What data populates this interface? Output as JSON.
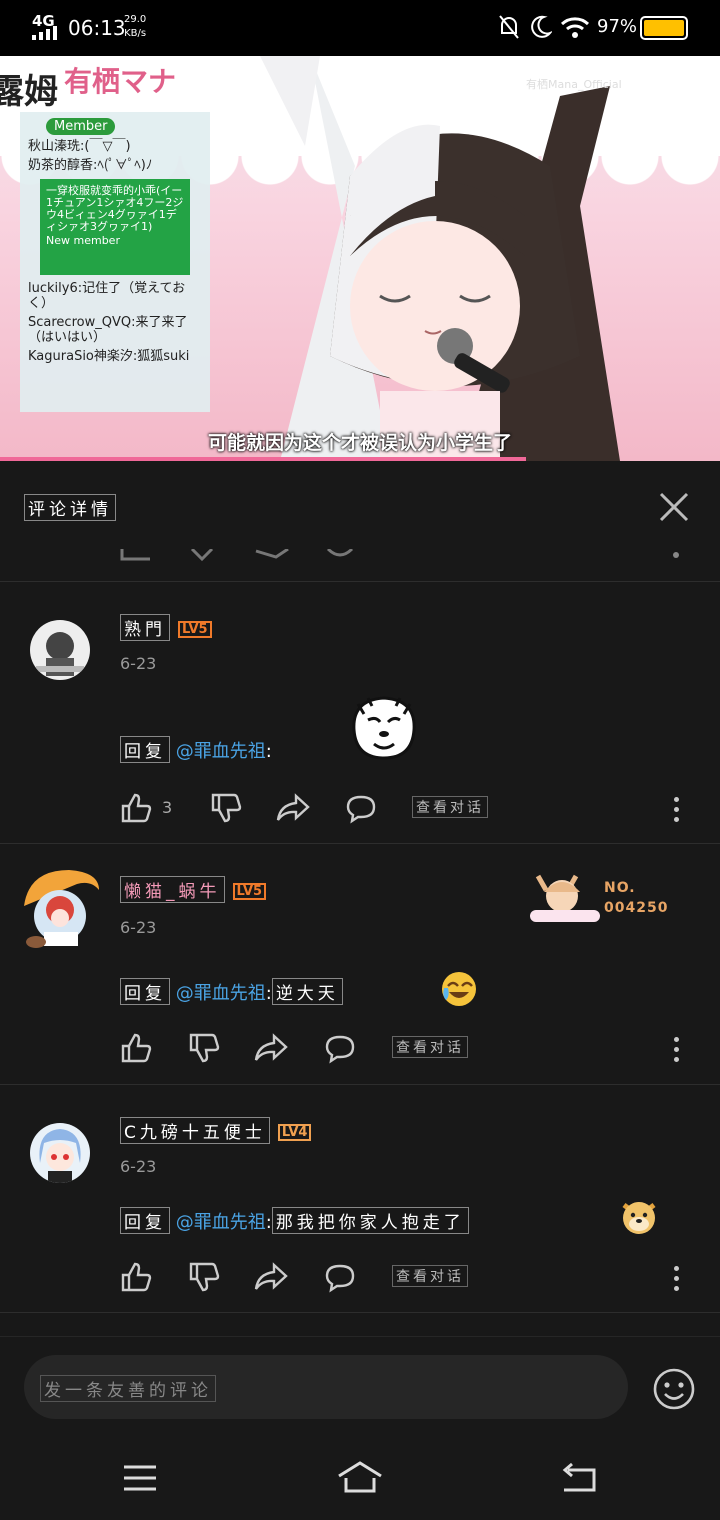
{
  "status_bar": {
    "network": "4G",
    "time": "06:13",
    "speed_value": "29.0",
    "speed_unit": "KB/s",
    "battery": "97%"
  },
  "video": {
    "stream_name": "露姆",
    "logo": "有栖マナ",
    "watermark": "有栖Mana_Official",
    "subtitle": "可能就因为这个才被误认为小学生了",
    "progress": 0.73,
    "chat": {
      "badge": "Member",
      "lines": [
        {
          "user": "秋山溱珗:",
          "text": "(￣▽￣)"
        },
        {
          "user": "奶茶的醇香:",
          "text": "ﾍ(ﾟ∀ﾟﾍ)ﾉ"
        },
        {
          "user": "luckily6:",
          "text": "记住了（覚えておく）"
        },
        {
          "user": "Scarecrow_QVQ:",
          "text": "来了来了（はいはい）"
        },
        {
          "user": "KaguraSio神楽汐:",
          "text": "狐狐suki"
        }
      ],
      "new_member_text": "一穿校服就变乖的小乖(イー1チュアン1シァオ4フー2ジウ4ビィェン4グヮァイ1ディシァオ3グヮァイ1)",
      "new_member_label": "New member"
    }
  },
  "panel": {
    "title": "评论详情"
  },
  "comments": [
    {
      "username": "熟門",
      "level": "LV5",
      "date": "6-23",
      "reply_prefix": "回复",
      "mention": "@罪血先祖",
      "colon": ":",
      "text": "",
      "emoji": "cat-sticker",
      "likes": "3",
      "view_conversation": "查看对话"
    },
    {
      "username": "懒猫_蜗牛",
      "level": "LV5",
      "date": "6-23",
      "reply_prefix": "回复",
      "mention": "@罪血先祖",
      "colon": ":",
      "text": "逆大天",
      "emoji": "laugh-cry-emoji",
      "likes": "",
      "view_conversation": "查看对话",
      "nameplate_no": "NO.",
      "nameplate_num": "004250"
    },
    {
      "username": "C九磅十五便士",
      "level": "LV4",
      "date": "6-23",
      "reply_prefix": "回复",
      "mention": "@罪血先祖",
      "colon": ":",
      "text": "那我把你家人抱走了",
      "emoji": "doge-emoji",
      "likes": "",
      "view_conversation": "查看对话"
    }
  ],
  "input": {
    "placeholder": "发一条友善的评论"
  },
  "colors": {
    "accent_pink": "#f06898",
    "mention_blue": "#4aa3e4",
    "lv5_orange": "#f07a2a",
    "lv4_orange": "#f0a050"
  }
}
